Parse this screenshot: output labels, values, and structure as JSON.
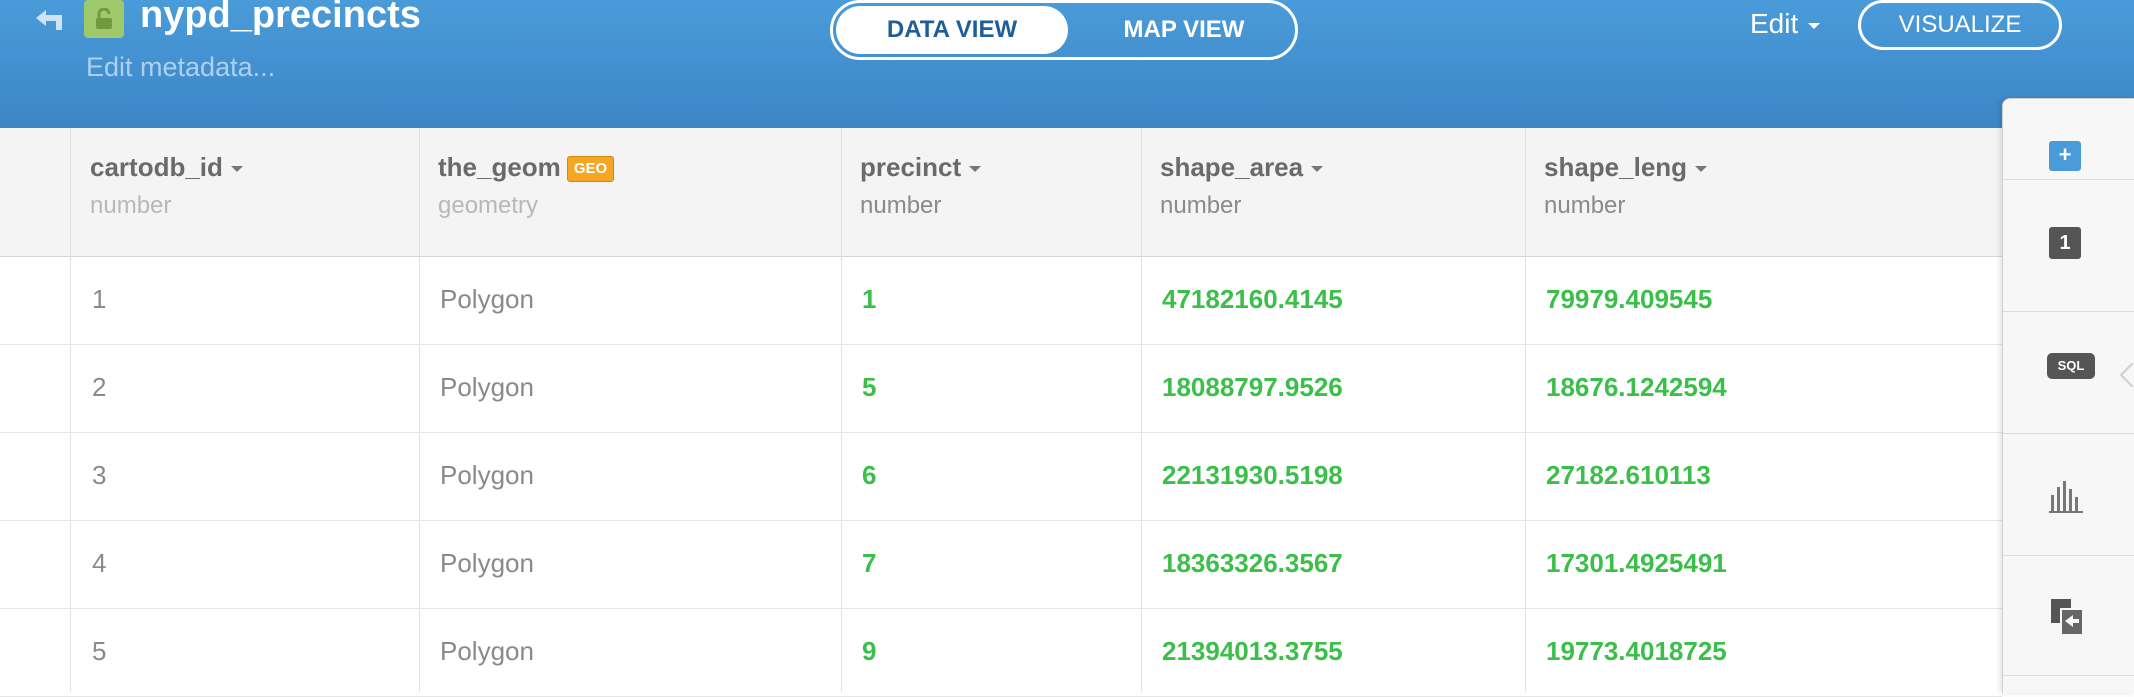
{
  "header": {
    "table_name": "nypd_precincts",
    "edit_metadata": "Edit metadata...",
    "tabs": {
      "data_view": "DATA VIEW",
      "map_view": "MAP VIEW"
    },
    "edit_label": "Edit",
    "visualize_label": "VISUALIZE",
    "colors": {
      "header_bg": "#4a9bd9",
      "lock_badge": "#9fc86a",
      "green_value": "#3cbf4a",
      "geo_badge": "#f5a623"
    }
  },
  "columns": [
    {
      "name": "cartodb_id",
      "type": "number"
    },
    {
      "name": "the_geom",
      "type": "geometry",
      "badge": "GEO"
    },
    {
      "name": "precinct",
      "type": "number"
    },
    {
      "name": "shape_area",
      "type": "number"
    },
    {
      "name": "shape_leng",
      "type": "number"
    }
  ],
  "rows": [
    {
      "cartodb_id": "1",
      "the_geom": "Polygon",
      "precinct": "1",
      "shape_area": "47182160.4145",
      "shape_leng": "79979.409545"
    },
    {
      "cartodb_id": "2",
      "the_geom": "Polygon",
      "precinct": "5",
      "shape_area": "18088797.9526",
      "shape_leng": "18676.1242594"
    },
    {
      "cartodb_id": "3",
      "the_geom": "Polygon",
      "precinct": "6",
      "shape_area": "22131930.5198",
      "shape_leng": "27182.610113"
    },
    {
      "cartodb_id": "4",
      "the_geom": "Polygon",
      "precinct": "7",
      "shape_area": "18363326.3567",
      "shape_leng": "17301.4925491"
    },
    {
      "cartodb_id": "5",
      "the_geom": "Polygon",
      "precinct": "9",
      "shape_area": "21394013.3755",
      "shape_leng": "19773.4018725"
    }
  ],
  "side_panel": {
    "add_label": "+",
    "layer_number": "1",
    "sql_label": "SQL",
    "icons": [
      "add-icon",
      "layer-number-badge",
      "sql-icon",
      "chart-icon",
      "export-icon"
    ]
  }
}
